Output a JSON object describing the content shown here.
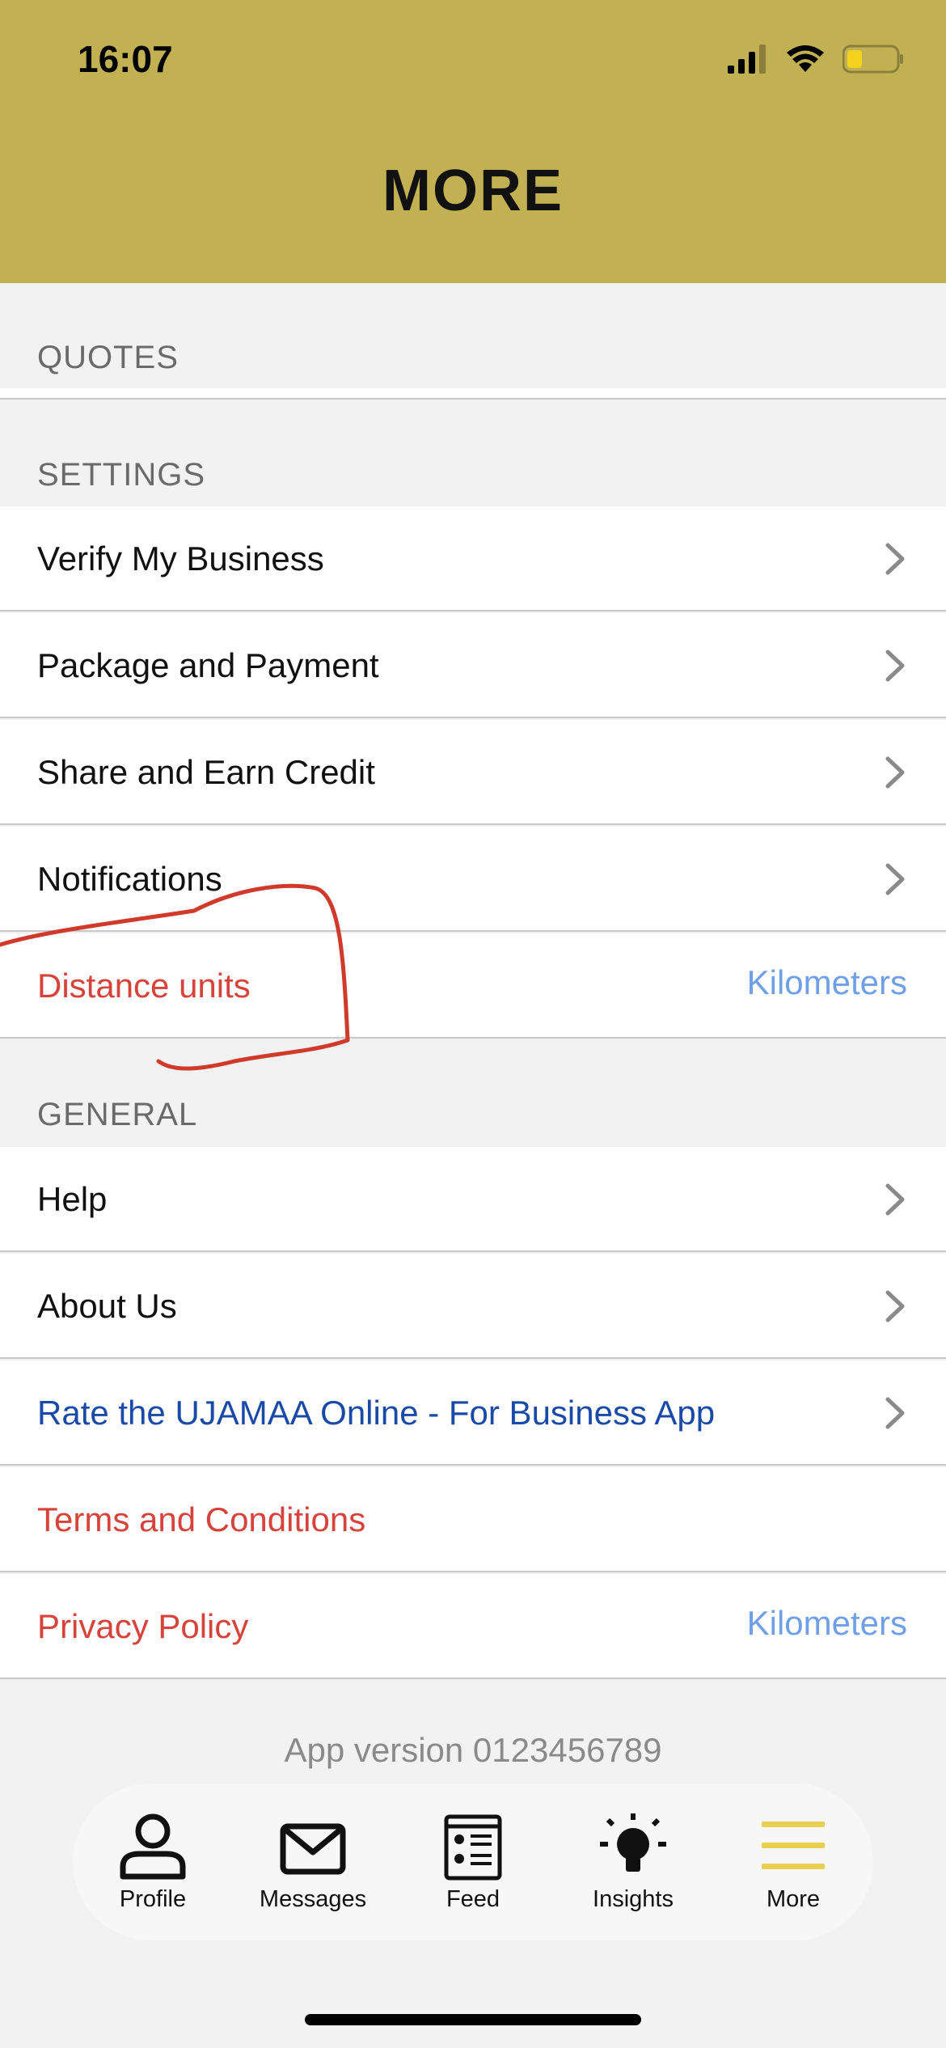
{
  "status_bar": {
    "time": "16:07"
  },
  "header": {
    "title": "MORE"
  },
  "sections": {
    "quotes": {
      "label": "QUOTES"
    },
    "settings": {
      "label": "SETTINGS",
      "items": [
        {
          "label": "Verify My Business"
        },
        {
          "label": "Package and Payment"
        },
        {
          "label": "Share and Earn Credit"
        },
        {
          "label": "Notifications"
        },
        {
          "label": "Distance units",
          "value": "Kilometers"
        }
      ]
    },
    "general": {
      "label": "GENERAL",
      "items": [
        {
          "label": "Help"
        },
        {
          "label": "About Us"
        },
        {
          "label": "Rate the UJAMAA Online - For Business App"
        },
        {
          "label": "Terms and Conditions"
        },
        {
          "label": "Privacy Policy",
          "value": "Kilometers"
        }
      ]
    }
  },
  "footer": {
    "app_version": "App version 0123456789"
  },
  "tabbar": {
    "items": [
      {
        "label": "Profile",
        "icon": "person-icon"
      },
      {
        "label": "Messages",
        "icon": "envelope-icon"
      },
      {
        "label": "Feed",
        "icon": "feed-icon"
      },
      {
        "label": "Insights",
        "icon": "lightbulb-icon"
      },
      {
        "label": "More",
        "icon": "menu-icon"
      }
    ]
  },
  "colors": {
    "header_bg": "#c1b152",
    "accent_value": "#6f9fe6",
    "link_red": "#d6433a",
    "link_blue": "#1a4aa8",
    "active_tab": "#e8cf52"
  }
}
